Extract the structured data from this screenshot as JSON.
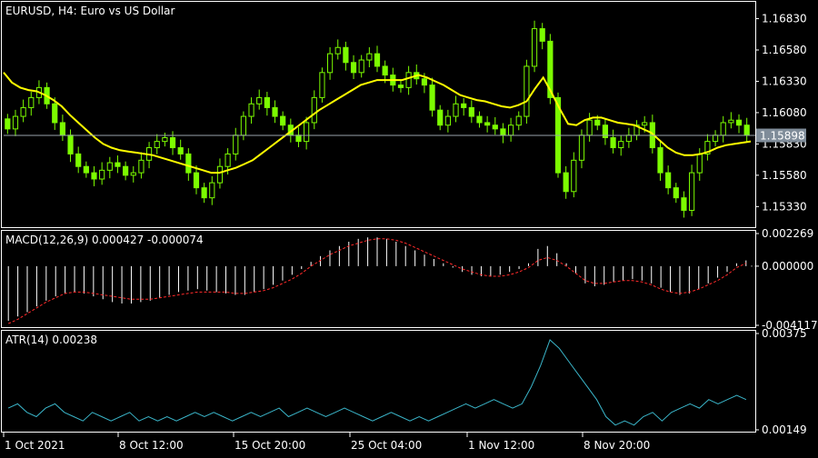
{
  "colors": {
    "background": "#000000",
    "frame": "#ffffff",
    "candle": "#7CFC00",
    "moving_average": "#FFFF00",
    "macd_histogram": "#ffffff",
    "macd_signal": "#FF2A2A",
    "atr_line": "#3AB5C9",
    "price_line": "#9aa3ad",
    "price_tag_bg": "#7f8c99",
    "dotted_zero": "#888888"
  },
  "main_panel": {
    "title": "EURUSD, H4:  Euro vs US Dollar",
    "current_price_tag": "1.15898",
    "y_ticks": [
      "1.16830",
      "1.16580",
      "1.16330",
      "1.16080",
      "1.15830",
      "1.15580",
      "1.15330"
    ]
  },
  "macd_panel": {
    "title": "MACD(12,26,9) 0.000427 -0.000074",
    "y_ticks": [
      "0.002269",
      "0.000000",
      "-0.004117"
    ]
  },
  "atr_panel": {
    "title": "ATR(14) 0.00238",
    "y_ticks": [
      "0.00375",
      "0.00149"
    ]
  },
  "x_axis": {
    "labels": [
      "1 Oct 2021",
      "8 Oct 12:00",
      "15 Oct 20:00",
      "25 Oct 04:00",
      "1 Nov 12:00",
      "8 Nov 20:00"
    ]
  },
  "chart_data": [
    {
      "type": "candlestick",
      "symbol": "EURUSD",
      "timeframe": "H4",
      "ylim": [
        1.1518,
        1.1695
      ],
      "current_price": 1.15898,
      "close_series": [
        1.1595,
        1.1605,
        1.1612,
        1.162,
        1.1628,
        1.1615,
        1.16,
        1.159,
        1.1575,
        1.1565,
        1.156,
        1.1555,
        1.1562,
        1.1568,
        1.1565,
        1.1558,
        1.156,
        1.157,
        1.158,
        1.1585,
        1.1588,
        1.158,
        1.1575,
        1.156,
        1.1548,
        1.154,
        1.1552,
        1.1565,
        1.1575,
        1.159,
        1.1605,
        1.1615,
        1.162,
        1.1612,
        1.1605,
        1.1598,
        1.159,
        1.1585,
        1.16,
        1.162,
        1.164,
        1.1655,
        1.166,
        1.1648,
        1.164,
        1.165,
        1.1655,
        1.1645,
        1.1638,
        1.163,
        1.1628,
        1.164,
        1.1635,
        1.163,
        1.161,
        1.1598,
        1.1605,
        1.1615,
        1.1612,
        1.1605,
        1.16,
        1.1598,
        1.1595,
        1.159,
        1.1598,
        1.1605,
        1.1645,
        1.1675,
        1.1665,
        1.162,
        1.156,
        1.1545,
        1.157,
        1.159,
        1.1602,
        1.1598,
        1.1588,
        1.158,
        1.1585,
        1.159,
        1.1598,
        1.16,
        1.158,
        1.156,
        1.1548,
        1.154,
        1.153,
        1.156,
        1.1575,
        1.1585,
        1.159,
        1.16,
        1.1602,
        1.1598,
        1.159
      ],
      "moving_average": [
        1.164,
        1.1632,
        1.1628,
        1.1626,
        1.1625,
        1.1622,
        1.1618,
        1.1613,
        1.1606,
        1.16,
        1.1594,
        1.1588,
        1.1583,
        1.158,
        1.1578,
        1.1577,
        1.1576,
        1.1575,
        1.1574,
        1.1572,
        1.157,
        1.1568,
        1.1566,
        1.1564,
        1.1562,
        1.156,
        1.156,
        1.1562,
        1.1564,
        1.1567,
        1.157,
        1.1575,
        1.158,
        1.1585,
        1.159,
        1.1595,
        1.16,
        1.1605,
        1.161,
        1.1614,
        1.1618,
        1.1622,
        1.1626,
        1.163,
        1.1632,
        1.1634,
        1.1634,
        1.1634,
        1.1634,
        1.1636,
        1.1638,
        1.1636,
        1.1633,
        1.163,
        1.1626,
        1.1622,
        1.162,
        1.1618,
        1.1617,
        1.1615,
        1.1613,
        1.1612,
        1.1614,
        1.1617,
        1.1627,
        1.1636,
        1.1624,
        1.1611,
        1.1599,
        1.1598,
        1.1602,
        1.1604,
        1.1604,
        1.1602,
        1.16,
        1.1599,
        1.1598,
        1.1595,
        1.1592,
        1.1586,
        1.158,
        1.1576,
        1.1574,
        1.1574,
        1.1575,
        1.1577,
        1.158,
        1.1582,
        1.1583,
        1.1584,
        1.1585
      ]
    },
    {
      "type": "bar",
      "name": "MACD(12,26,9)",
      "ylim": [
        -0.004117,
        0.002269
      ],
      "histogram": [
        -0.0038,
        -0.0035,
        -0.0032,
        -0.0028,
        -0.0024,
        -0.0021,
        -0.0019,
        -0.0018,
        -0.0019,
        -0.0021,
        -0.0023,
        -0.0025,
        -0.0026,
        -0.0026,
        -0.0025,
        -0.0024,
        -0.0022,
        -0.002,
        -0.0018,
        -0.0017,
        -0.0016,
        -0.0017,
        -0.0018,
        -0.0019,
        -0.002,
        -0.002,
        -0.0018,
        -0.0016,
        -0.0013,
        -0.001,
        -0.0006,
        -0.0002,
        0.0003,
        0.0007,
        0.0011,
        0.0014,
        0.0017,
        0.0019,
        0.002,
        0.002,
        0.0019,
        0.0017,
        0.0014,
        0.0011,
        0.0008,
        0.0005,
        0.0002,
        -0.0001,
        -0.0004,
        -0.0006,
        -0.0007,
        -0.0007,
        -0.0006,
        -0.0004,
        -0.0002,
        0.0002,
        0.0012,
        0.0014,
        0.0009,
        0.0002,
        -0.0005,
        -0.0012,
        -0.0014,
        -0.0013,
        -0.0011,
        -0.001,
        -0.0009,
        -0.001,
        -0.0012,
        -0.0015,
        -0.0018,
        -0.002,
        -0.0019,
        -0.0016,
        -0.0012,
        -0.0008,
        -0.0004,
        0.0002,
        0.0004
      ],
      "signal": [
        -0.004,
        -0.0037,
        -0.0033,
        -0.0029,
        -0.0025,
        -0.0022,
        -0.0019,
        -0.0018,
        -0.0018,
        -0.0019,
        -0.002,
        -0.0021,
        -0.0022,
        -0.0023,
        -0.0023,
        -0.0023,
        -0.0022,
        -0.0021,
        -0.002,
        -0.0019,
        -0.0018,
        -0.0018,
        -0.0018,
        -0.0018,
        -0.0019,
        -0.0019,
        -0.0018,
        -0.0017,
        -0.0015,
        -0.0012,
        -0.0009,
        -0.0005,
        0.0,
        0.0004,
        0.0008,
        0.0011,
        0.0014,
        0.0016,
        0.0018,
        0.0019,
        0.0019,
        0.0018,
        0.0016,
        0.0013,
        0.001,
        0.0007,
        0.0004,
        0.0001,
        -0.0002,
        -0.0004,
        -0.0006,
        -0.0007,
        -0.0007,
        -0.0006,
        -0.0004,
        -0.0001,
        0.0004,
        0.0006,
        0.0004,
        0.0,
        -0.0005,
        -0.001,
        -0.0012,
        -0.0012,
        -0.0011,
        -0.001,
        -0.001,
        -0.0011,
        -0.0013,
        -0.0016,
        -0.0018,
        -0.0019,
        -0.0018,
        -0.0016,
        -0.0013,
        -0.001,
        -0.0006,
        -0.0001,
        0.0002
      ]
    },
    {
      "type": "line",
      "name": "ATR(14)",
      "ylim": [
        0.00149,
        0.00375
      ],
      "values": [
        0.002,
        0.0021,
        0.0019,
        0.0018,
        0.002,
        0.0021,
        0.0019,
        0.0018,
        0.0017,
        0.0019,
        0.0018,
        0.0017,
        0.0018,
        0.0019,
        0.0017,
        0.0018,
        0.0017,
        0.0018,
        0.0017,
        0.0018,
        0.0019,
        0.0018,
        0.0019,
        0.0018,
        0.0017,
        0.0018,
        0.0019,
        0.0018,
        0.0019,
        0.002,
        0.0018,
        0.0019,
        0.002,
        0.0019,
        0.0018,
        0.0019,
        0.002,
        0.0019,
        0.0018,
        0.0017,
        0.0018,
        0.0019,
        0.0018,
        0.0017,
        0.0018,
        0.0017,
        0.0018,
        0.0019,
        0.002,
        0.0021,
        0.002,
        0.0021,
        0.0022,
        0.0021,
        0.002,
        0.0021,
        0.0025,
        0.003,
        0.0036,
        0.0034,
        0.0031,
        0.0028,
        0.0025,
        0.0022,
        0.0018,
        0.0016,
        0.0017,
        0.0016,
        0.0018,
        0.0019,
        0.0017,
        0.0019,
        0.002,
        0.0021,
        0.002,
        0.0022,
        0.0021,
        0.0022,
        0.0023,
        0.0022
      ]
    }
  ]
}
